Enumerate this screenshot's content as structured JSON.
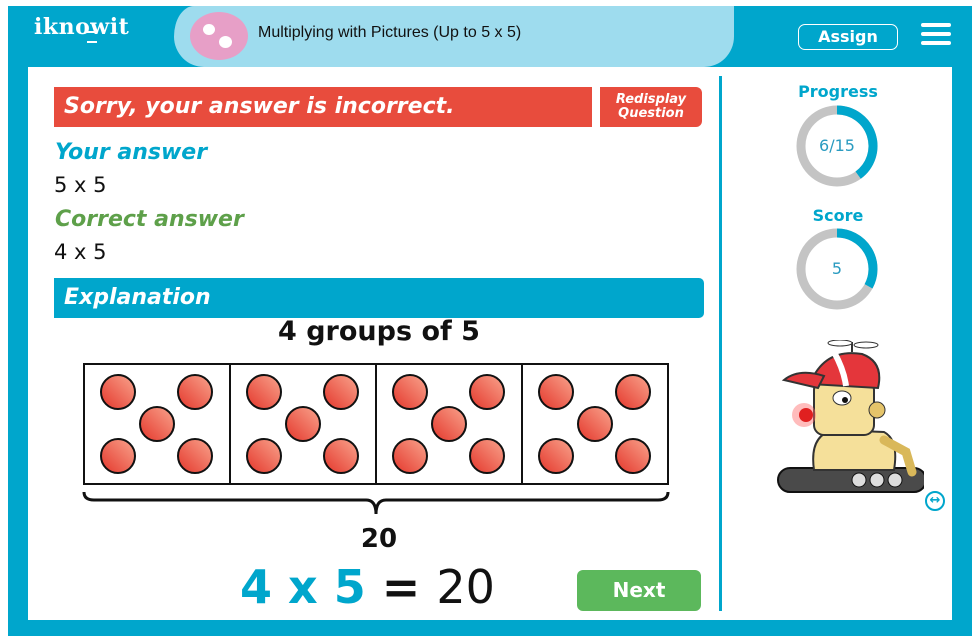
{
  "header": {
    "logo_text": "iknowit",
    "topic_title": "Multiplying with Pictures (Up to 5 x 5)",
    "assign_label": "Assign",
    "menu_icon": "hamburger-menu-icon"
  },
  "feedback": {
    "status_message": "Sorry, your answer is incorrect.",
    "redisplay_label_line1": "Redisplay",
    "redisplay_label_line2": "Question",
    "your_answer_label": "Your answer",
    "your_answer_value": "5 x 5",
    "correct_answer_label": "Correct answer",
    "correct_answer_value": "4 x 5"
  },
  "explanation": {
    "heading": "Explanation",
    "groups_caption": "4 groups of 5",
    "group_count": 4,
    "items_per_group": 5,
    "total": "20",
    "equation": {
      "factor_a": "4",
      "times": "x",
      "factor_b": "5",
      "equals": "=",
      "product": "20"
    }
  },
  "actions": {
    "next_label": "Next"
  },
  "sidebar": {
    "progress_label": "Progress",
    "progress_value": "6/15",
    "progress_fraction": 0.4,
    "score_label": "Score",
    "score_value": "5",
    "score_fraction": 0.33,
    "swap_icon": "swap-arrows-icon"
  },
  "colors": {
    "brand_blue": "#00a6cc",
    "light_blue": "#9edcee",
    "error_red": "#e84c3d",
    "correct_green": "#5ea04a",
    "next_green": "#5cb85c",
    "ring_gray": "#c4c4c4"
  }
}
